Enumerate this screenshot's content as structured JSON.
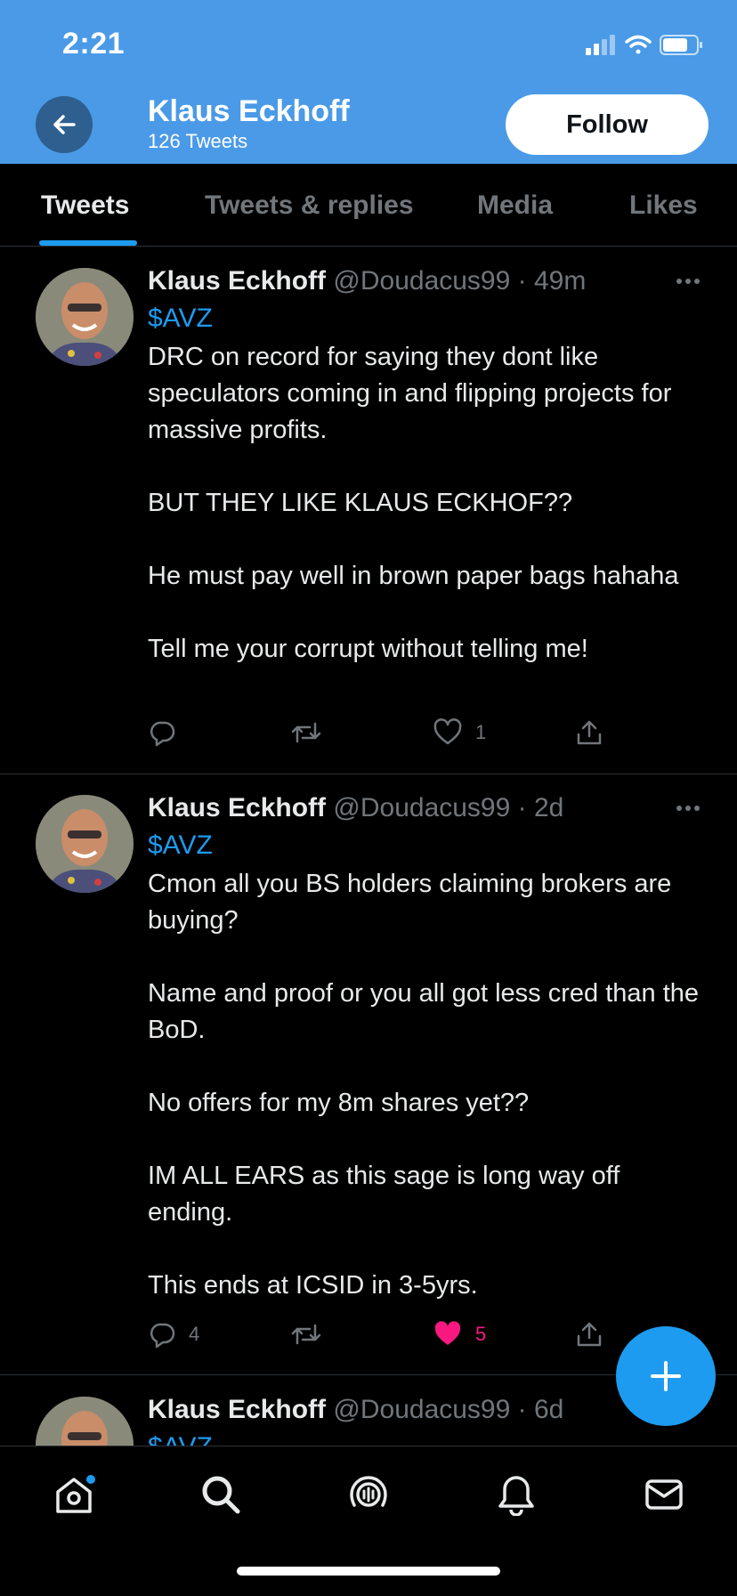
{
  "status_bar": {
    "time": "2:21"
  },
  "header": {
    "name": "Klaus Eckhoff",
    "tweet_count": "126 Tweets",
    "follow_label": "Follow"
  },
  "tabs": [
    {
      "label": "Tweets",
      "active": true
    },
    {
      "label": "Tweets & replies",
      "active": false
    },
    {
      "label": "Media",
      "active": false
    },
    {
      "label": "Likes",
      "active": false
    }
  ],
  "tweets": [
    {
      "name": "Klaus Eckhoff",
      "handle": "@Doudacus99",
      "time": "49m",
      "cashtag": "$AVZ",
      "text": "DRC on record for saying they dont like speculators coming in and flipping projects for massive profits.\n\nBUT THEY LIKE KLAUS ECKHOF??\n\nHe must pay well in brown paper bags hahaha\n\nTell me your corrupt without telling me!",
      "replies": "",
      "retweets": "",
      "likes": "1",
      "liked": false
    },
    {
      "name": "Klaus Eckhoff",
      "handle": "@Doudacus99",
      "time": "2d",
      "cashtag": "$AVZ",
      "text": "Cmon all you BS holders claiming brokers are buying?\n\nName and proof or you all got less cred than the BoD.\n\nNo offers for my 8m shares yet??\n\nIM ALL EARS as this sage is long way off ending.\n\nThis ends at ICSID in 3-5yrs.",
      "replies": "4",
      "retweets": "",
      "likes": "5",
      "liked": true
    },
    {
      "name": "Klaus Eckhoff",
      "handle": "@Doudacus99",
      "time": "6d",
      "cashtag": "$AVZ"
    }
  ],
  "separator": "·",
  "colors": {
    "header_bg": "#4a9ae7",
    "accent": "#1d9bf0",
    "like": "#f91880",
    "muted": "#71767b"
  },
  "icons": {
    "back": "arrow-left-icon",
    "more": "more-horizontal-icon",
    "reply": "reply-icon",
    "retweet": "retweet-icon",
    "like": "heart-icon",
    "share": "share-icon",
    "compose": "plus-icon",
    "nav": [
      "home-icon",
      "search-icon",
      "spaces-icon",
      "notifications-icon",
      "messages-icon"
    ]
  }
}
